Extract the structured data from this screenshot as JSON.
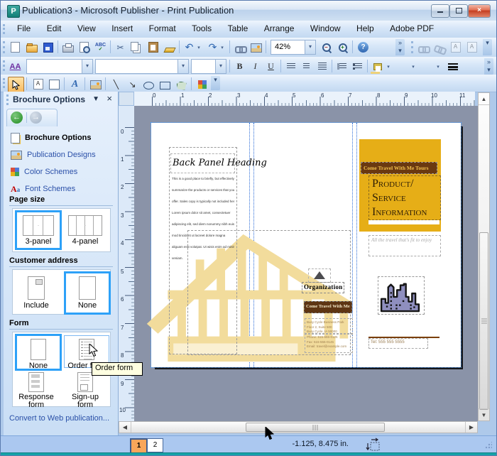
{
  "window": {
    "title": "Publication3 - Microsoft Publisher - Print Publication",
    "app_icon": "P",
    "close_glyph": "×"
  },
  "menu_bar": {
    "items": [
      "File",
      "Edit",
      "View",
      "Insert",
      "Format",
      "Tools",
      "Table",
      "Arrange",
      "Window",
      "Help",
      "Adobe PDF"
    ]
  },
  "toolbars": {
    "zoom_value": "42%",
    "glyphs": {
      "cut": "✂",
      "undo": "↶",
      "redo": "↷",
      "dropdown": "▾",
      "chevron": "»",
      "spelling": "ABC",
      "check": "✓",
      "bold": "B",
      "italic": "I",
      "underline": "U",
      "styles": "AA",
      "wordart": "A",
      "line": "╲",
      "arrow": "↘",
      "font_color": "A",
      "zoom_out": "–",
      "zoom_in": "+",
      "help": "?",
      "scroll_up": "▲",
      "scroll_down": "▼",
      "scroll_left": "◀",
      "scroll_right": "▶",
      "select_arrow": "➤"
    }
  },
  "task_pane": {
    "title": "Brochure Options",
    "menu_glyph": "▼",
    "close_glyph": "×",
    "back_glyph": "←",
    "forward_glyph": "→",
    "nav_items": [
      {
        "label": "Brochure Options"
      },
      {
        "label": "Publication Designs"
      },
      {
        "label": "Color Schemes"
      },
      {
        "label": "Font Schemes"
      }
    ],
    "sections": {
      "page_size": {
        "title": "Page size",
        "options": [
          "3-panel",
          "4-panel"
        ],
        "selected": "3-panel"
      },
      "customer_address": {
        "title": "Customer address",
        "options": [
          "Include",
          "None"
        ],
        "selected": "None"
      },
      "form": {
        "title": "Form",
        "options": [
          "None",
          "Order form",
          "Response form",
          "Sign-up form"
        ],
        "selected": "None",
        "hovered": "Order form"
      }
    },
    "footer_link": "Convert to Web publication..."
  },
  "tooltip": "Order form",
  "rulers": {
    "horizontal": [
      "0",
      "1",
      "2",
      "3",
      "4",
      "5",
      "6",
      "7",
      "8",
      "9",
      "10",
      "11"
    ],
    "vertical": [
      "0",
      "1",
      "2",
      "3",
      "4",
      "5",
      "6",
      "7",
      "8",
      "9",
      "10"
    ]
  },
  "document": {
    "back_panel": {
      "heading": "Back Panel Heading",
      "body": [
        "This is a good place to briefly, but effectively,",
        "summarize the products or services that you",
        "offer. Sales copy is typically not included here.",
        "Lorem ipsum dolor sit amet, consectetuer",
        "adipiscing elit, sed diem nonummy nibh euis-",
        "mod tincidunt ut lacreet dolore magna",
        "aliguam erat volutpat. Ut wisis enim ad minim",
        "veniam."
      ]
    },
    "center_panel": {
      "organization": "Organization",
      "tagline_bar": "Come Travel With Me",
      "address_lines": [
        "Busy Cycle Business Park",
        "Floor 2, Suite 500",
        "Busy Cycle, IA 50000"
      ],
      "contact_lines": [
        "Phone: 515-555-0125",
        "Fax: 515-555-0145",
        "Email: travel@example.com"
      ]
    },
    "front_panel": {
      "org_bar": "Come Travel With Me Tours",
      "title_lines": [
        "Product/",
        "Service",
        "Information"
      ],
      "tagline": "All the travel that's fit to enjoy",
      "phone": "Tel: 555 555 5555"
    }
  },
  "status_bar": {
    "pages": [
      "1",
      "2"
    ],
    "current_page": "1",
    "position": "-1.125, 8.475 in."
  },
  "colors": {
    "accent_gold": "#e6ae17",
    "dark_brown": "#6a3910",
    "pale_yellow": "#f2dc9c",
    "logo_purple": "#8f8fbf",
    "selection_blue": "#2da1f8",
    "link_blue": "#2b50a8",
    "canvas_gray": "#8a93a8",
    "teal_strip": "#15a3a8"
  }
}
